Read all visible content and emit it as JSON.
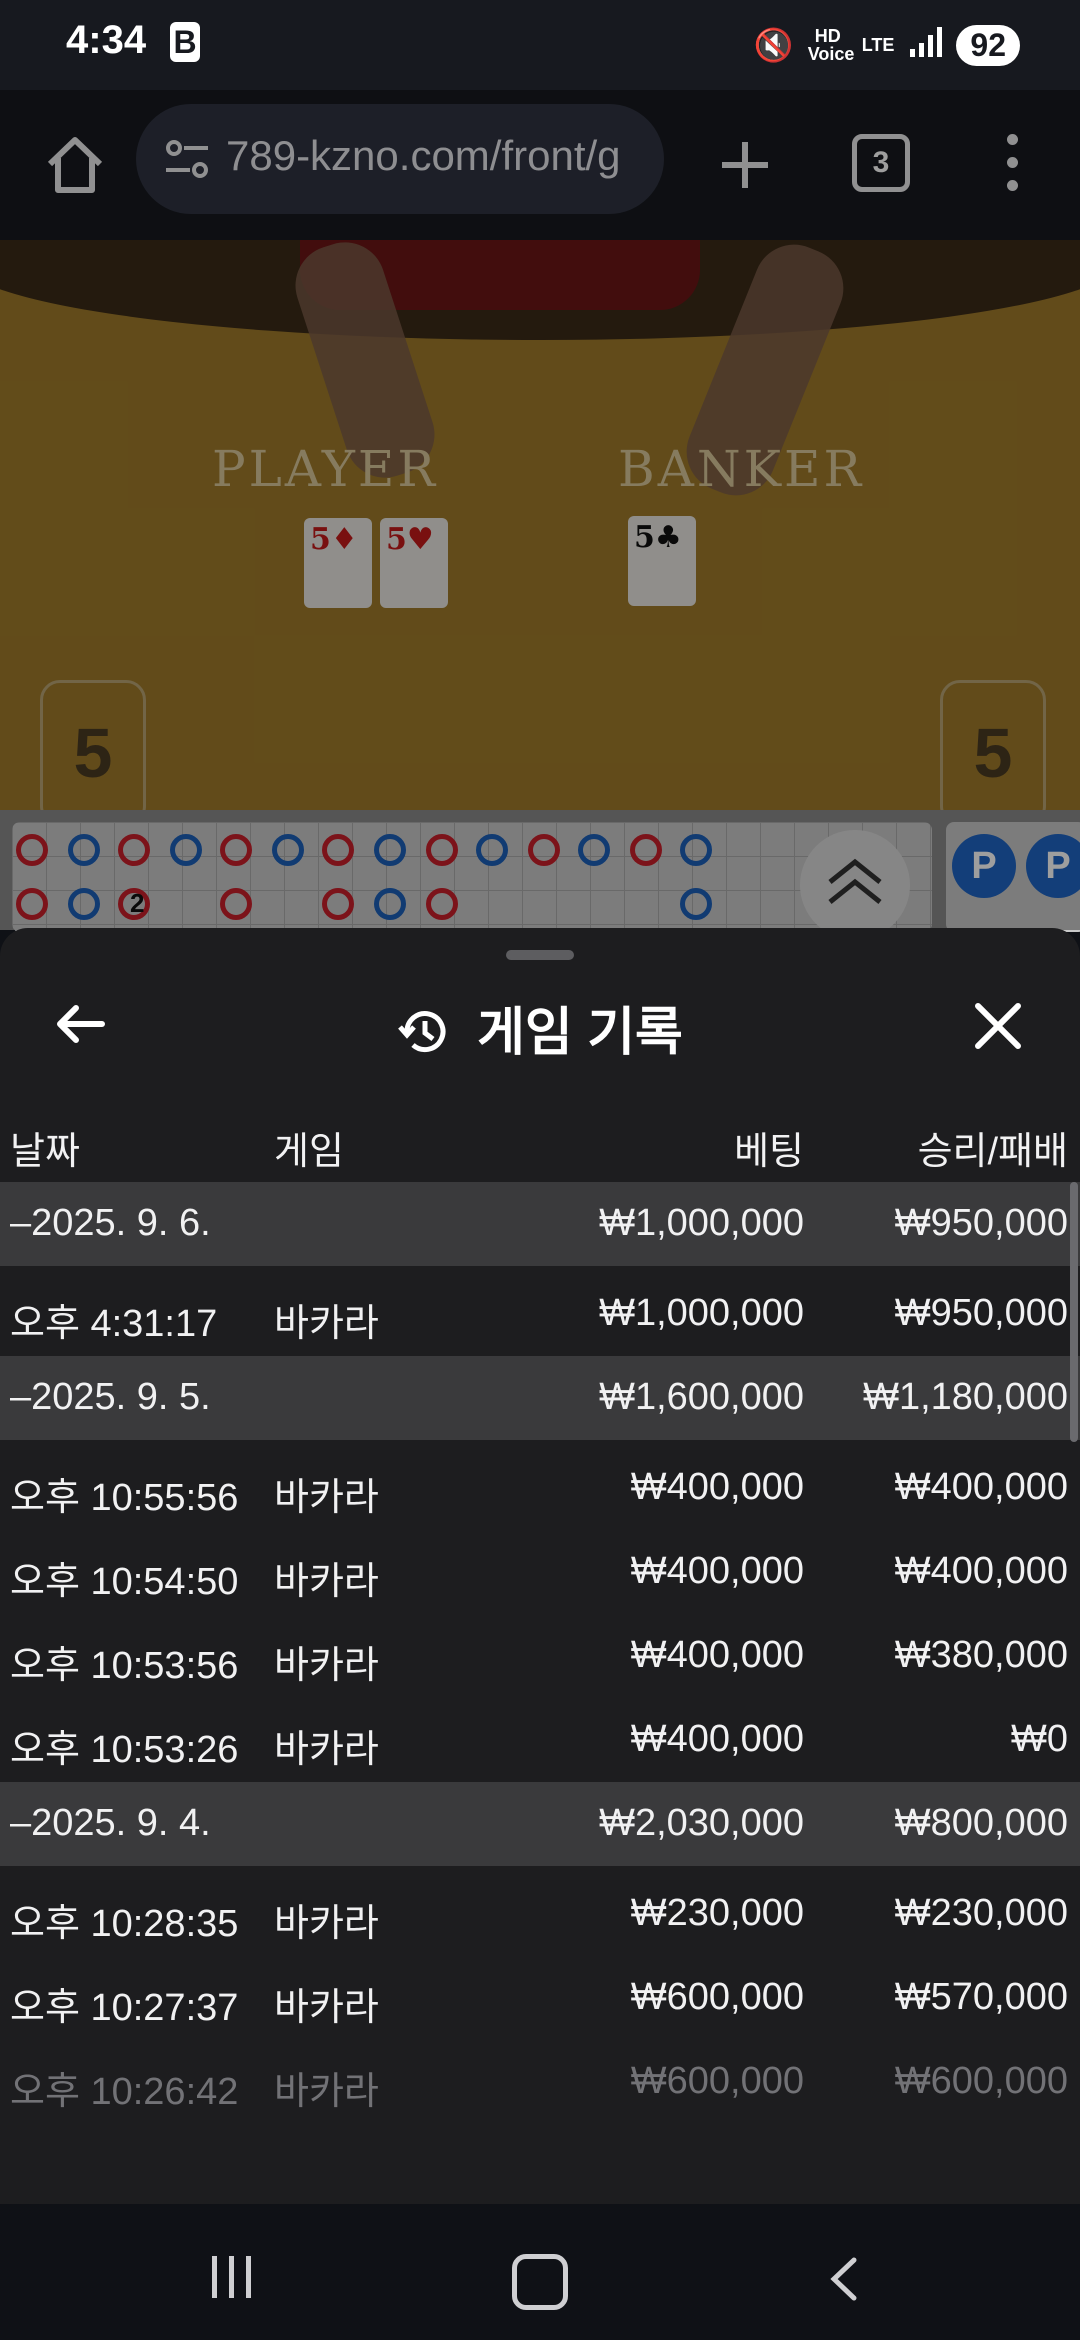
{
  "status_bar": {
    "time": "4:34",
    "b_icon": "B",
    "hd_voice": "HD Voice",
    "lte": "LTE",
    "battery": "92"
  },
  "browser": {
    "url": "789-kzno.com/front/g",
    "tab_count": "3"
  },
  "video": {
    "player_label": "PLAYER",
    "banker_label": "BANKER",
    "player_score": "5",
    "banker_score": "5",
    "player_cards": [
      "5♦",
      "5♥"
    ],
    "banker_cards": [
      "5♣"
    ]
  },
  "roadmap": {
    "pair_labels": [
      "P",
      "P"
    ],
    "tie_count": "2"
  },
  "sheet": {
    "title": "게임 기록",
    "headers": {
      "date": "날짜",
      "game": "게임",
      "bet": "베팅",
      "result": "승리/패배"
    },
    "rows": [
      {
        "type": "date",
        "date": "–2025. 9. 6.",
        "game": "",
        "bet": "₩1,000,000",
        "result": "₩950,000"
      },
      {
        "type": "item",
        "date": "오후 4:31:17",
        "game": "바카라",
        "bet": "₩1,000,000",
        "result": "₩950,000"
      },
      {
        "type": "date",
        "date": "–2025. 9. 5.",
        "game": "",
        "bet": "₩1,600,000",
        "result": "₩1,180,000"
      },
      {
        "type": "item",
        "date": "오후 10:55:56",
        "game": "바카라",
        "bet": "₩400,000",
        "result": "₩400,000"
      },
      {
        "type": "item",
        "date": "오후 10:54:50",
        "game": "바카라",
        "bet": "₩400,000",
        "result": "₩400,000"
      },
      {
        "type": "item",
        "date": "오후 10:53:56",
        "game": "바카라",
        "bet": "₩400,000",
        "result": "₩380,000"
      },
      {
        "type": "item",
        "date": "오후 10:53:26",
        "game": "바카라",
        "bet": "₩400,000",
        "result": "₩0"
      },
      {
        "type": "date",
        "date": "–2025. 9. 4.",
        "game": "",
        "bet": "₩2,030,000",
        "result": "₩800,000"
      },
      {
        "type": "item",
        "date": "오후 10:28:35",
        "game": "바카라",
        "bet": "₩230,000",
        "result": "₩230,000"
      },
      {
        "type": "item",
        "date": "오후 10:27:37",
        "game": "바카라",
        "bet": "₩600,000",
        "result": "₩570,000"
      },
      {
        "type": "faded",
        "date": "오후 10:26:42",
        "game": "바카라",
        "bet": "₩600,000",
        "result": "₩600,000"
      }
    ]
  },
  "colors": {
    "banker_red": "#c8202a",
    "player_blue": "#1c5fb8",
    "sheet_bg": "#1d1d1f",
    "date_row_bg": "#3a3a3c"
  }
}
